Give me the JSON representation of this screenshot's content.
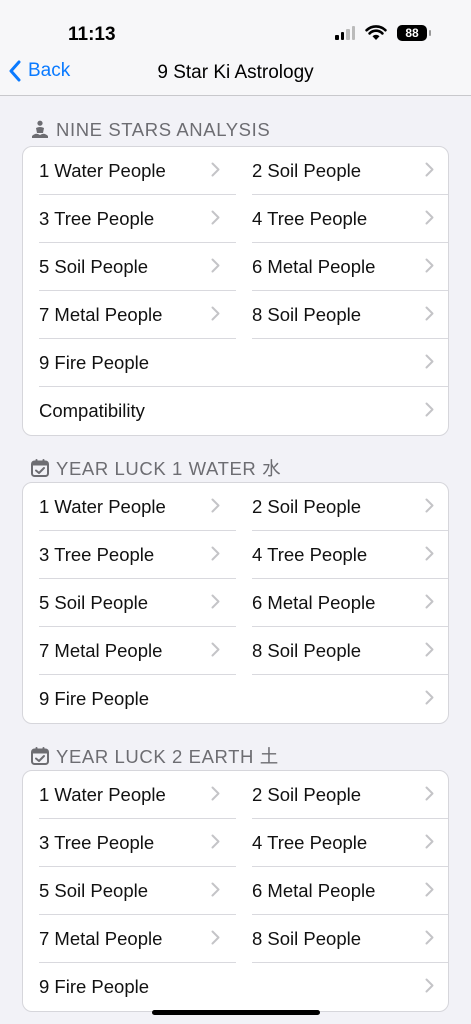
{
  "status": {
    "time": "11:13",
    "battery": "88"
  },
  "nav": {
    "back_label": "Back",
    "title": "9 Star Ki Astrology"
  },
  "sections": [
    {
      "header": "NINE STARS ANALYSIS",
      "icon": "meditation-person-icon",
      "pairs": [
        [
          "1 Water People",
          "2 Soil People"
        ],
        [
          "3 Tree People",
          "4 Tree People"
        ],
        [
          "5 Soil People",
          "6 Metal People"
        ],
        [
          "7 Metal People",
          "8 Soil People"
        ]
      ],
      "full": [
        "9 Fire People",
        "Compatibility"
      ]
    },
    {
      "header": "YEAR LUCK 1 WATER 水",
      "icon": "calendar-check-icon",
      "pairs": [
        [
          "1 Water People",
          "2 Soil People"
        ],
        [
          "3 Tree People",
          "4 Tree People"
        ],
        [
          "5 Soil People",
          "6 Metal People"
        ],
        [
          "7 Metal People",
          "8 Soil People"
        ]
      ],
      "full": [
        "9 Fire People"
      ]
    },
    {
      "header": "YEAR LUCK 2 EARTH 土",
      "icon": "calendar-check-icon",
      "pairs": [
        [
          "1 Water People",
          "2 Soil People"
        ],
        [
          "3 Tree People",
          "4 Tree People"
        ],
        [
          "5 Soil People",
          "6 Metal People"
        ],
        [
          "7 Metal People",
          "8 Soil People"
        ]
      ],
      "full": [
        "9 Fire People"
      ]
    }
  ],
  "colors": {
    "accent": "#0a7aff",
    "background": "#f2f2f7",
    "header_text": "#6d6d72"
  }
}
